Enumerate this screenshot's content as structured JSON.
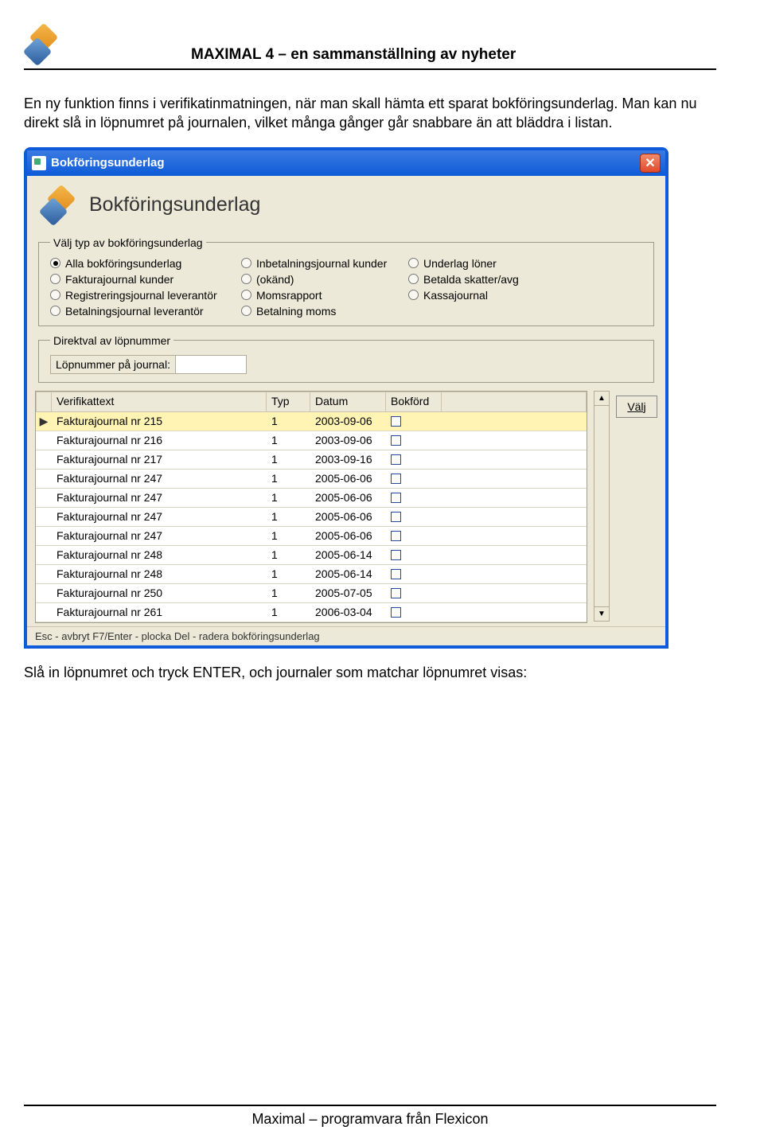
{
  "doc": {
    "header_title": "MAXIMAL 4 – en sammanställning av nyheter",
    "para1": "En ny funktion finns i verifikatinmatningen, när man skall hämta ett sparat bokföringsunderlag. Man kan nu direkt slå in löpnumret på journalen, vilket många gånger går snabbare än att bläddra i listan.",
    "para2": "Slå in löpnumret och tryck ENTER, och journaler som matchar löpnumret visas:",
    "footer": "Maximal – programvara från Flexicon"
  },
  "window": {
    "title": "Bokföringsunderlag",
    "heading": "Bokföringsunderlag",
    "group1_legend": "Välj typ av bokföringsunderlag",
    "radios": {
      "r0": "Alla bokföringsunderlag",
      "r1": "Fakturajournal kunder",
      "r2": "Registreringsjournal leverantör",
      "r3": "Betalningsjournal leverantör",
      "r4": "Inbetalningsjournal kunder",
      "r5": "(okänd)",
      "r6": "Momsrapport",
      "r7": "Betalning moms",
      "r8": "Underlag löner",
      "r9": "Betalda skatter/avg",
      "r10": "Kassajournal"
    },
    "selected_radio": 0,
    "group2_legend": "Direktval av löpnummer",
    "input_label": "Löpnummer på journal:",
    "input_value": "",
    "headers": {
      "h0": "",
      "h1": "Verifikattext",
      "h2": "Typ",
      "h3": "Datum",
      "h4": "Bokförd"
    },
    "rows": [
      {
        "text": "Fakturajournal nr 215",
        "typ": "1",
        "datum": "2003-09-06",
        "sel": true
      },
      {
        "text": "Fakturajournal nr 216",
        "typ": "1",
        "datum": "2003-09-06",
        "sel": false
      },
      {
        "text": "Fakturajournal nr 217",
        "typ": "1",
        "datum": "2003-09-16",
        "sel": false
      },
      {
        "text": "Fakturajournal nr 247",
        "typ": "1",
        "datum": "2005-06-06",
        "sel": false
      },
      {
        "text": "Fakturajournal nr 247",
        "typ": "1",
        "datum": "2005-06-06",
        "sel": false
      },
      {
        "text": "Fakturajournal nr 247",
        "typ": "1",
        "datum": "2005-06-06",
        "sel": false
      },
      {
        "text": "Fakturajournal nr 247",
        "typ": "1",
        "datum": "2005-06-06",
        "sel": false
      },
      {
        "text": "Fakturajournal nr 248",
        "typ": "1",
        "datum": "2005-06-14",
        "sel": false
      },
      {
        "text": "Fakturajournal nr 248",
        "typ": "1",
        "datum": "2005-06-14",
        "sel": false
      },
      {
        "text": "Fakturajournal nr 250",
        "typ": "1",
        "datum": "2005-07-05",
        "sel": false
      },
      {
        "text": "Fakturajournal nr 261",
        "typ": "1",
        "datum": "2006-03-04",
        "sel": false
      }
    ],
    "side_button": "Välj",
    "statusbar": "Esc - avbryt    F7/Enter - plocka    Del - radera bokföringsunderlag"
  }
}
